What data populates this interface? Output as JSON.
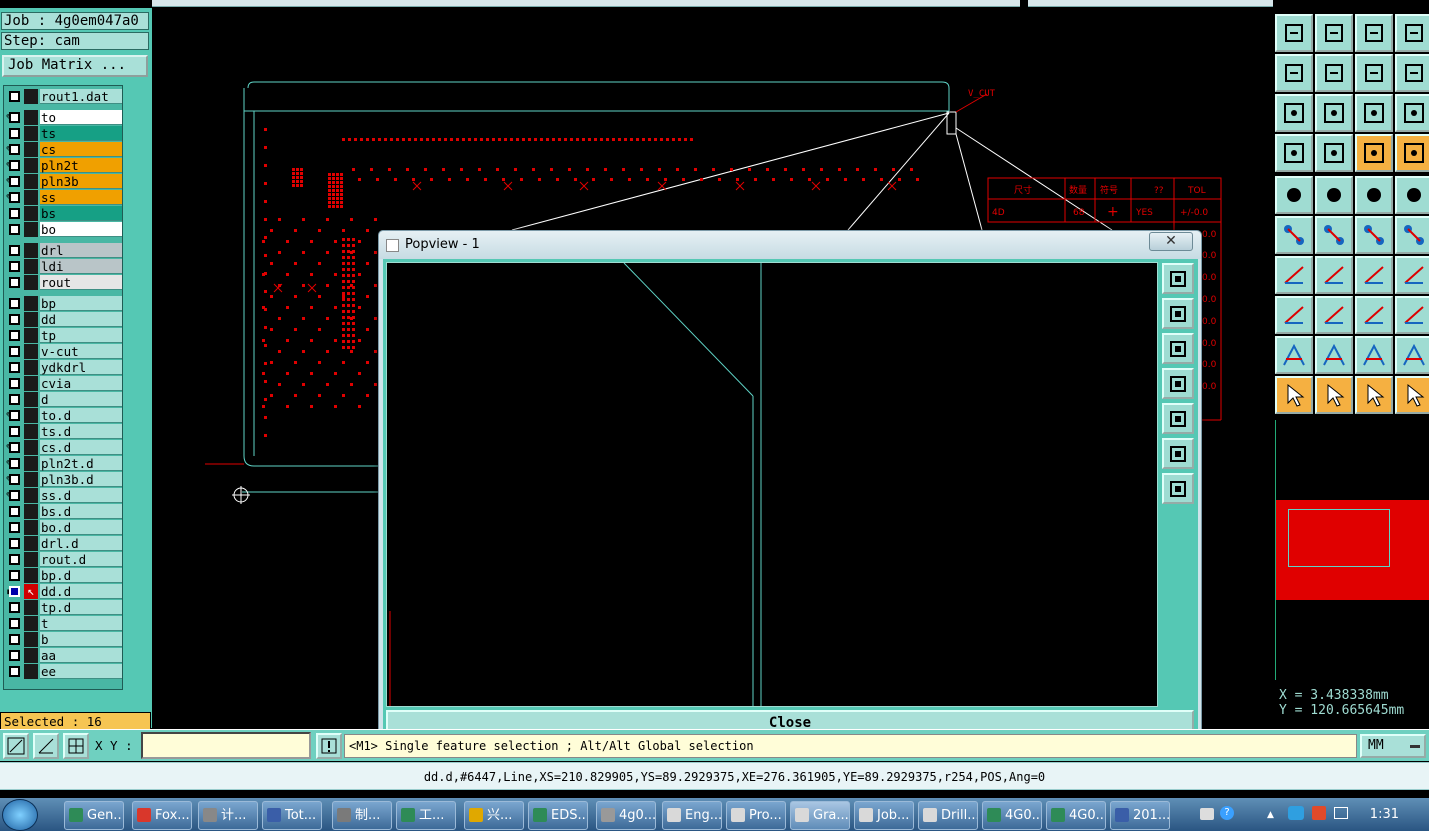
{
  "job": {
    "label": "Job : 4g0em047a0",
    "step": "Step: cam",
    "matrix_button": "Job Matrix ..."
  },
  "layers": [
    {
      "name": "rout1.dat",
      "color": "default",
      "icon": ""
    },
    {
      "name": "to",
      "color": "white",
      "icon": "hand-icon"
    },
    {
      "name": "ts",
      "color": "green",
      "icon": ""
    },
    {
      "name": "cs",
      "color": "orange",
      "icon": "hand-icon"
    },
    {
      "name": "pln2t",
      "color": "orange",
      "icon": "hand-icon"
    },
    {
      "name": "pln3b",
      "color": "orange",
      "icon": "hand-icon"
    },
    {
      "name": "ss",
      "color": "orange",
      "icon": "hand-icon"
    },
    {
      "name": "bs",
      "color": "green",
      "icon": ""
    },
    {
      "name": "bo",
      "color": "white",
      "icon": ""
    },
    {
      "name": "drl",
      "color": "gray",
      "icon": ""
    },
    {
      "name": "ldi",
      "color": "gray",
      "icon": ""
    },
    {
      "name": "rout",
      "color": "lgray",
      "icon": ""
    },
    {
      "name": "bp",
      "color": "default",
      "icon": ""
    },
    {
      "name": "dd",
      "color": "default",
      "icon": ""
    },
    {
      "name": "tp",
      "color": "default",
      "icon": ""
    },
    {
      "name": "v-cut",
      "color": "default",
      "icon": ""
    },
    {
      "name": "ydkdrl",
      "color": "default",
      "icon": ""
    },
    {
      "name": "cvia",
      "color": "default",
      "icon": ""
    },
    {
      "name": "d",
      "color": "default",
      "icon": ""
    },
    {
      "name": "to.d",
      "color": "default",
      "icon": "hand-icon"
    },
    {
      "name": "ts.d",
      "color": "default",
      "icon": ""
    },
    {
      "name": "cs.d",
      "color": "default",
      "icon": "hand-icon"
    },
    {
      "name": "pln2t.d",
      "color": "default",
      "icon": "hand-icon"
    },
    {
      "name": "pln3b.d",
      "color": "default",
      "icon": "hand-icon"
    },
    {
      "name": "ss.d",
      "color": "default",
      "icon": "hand-icon"
    },
    {
      "name": "bs.d",
      "color": "default",
      "icon": ""
    },
    {
      "name": "bo.d",
      "color": "default",
      "icon": ""
    },
    {
      "name": "drl.d",
      "color": "default",
      "icon": ""
    },
    {
      "name": "rout.d",
      "color": "default",
      "icon": ""
    },
    {
      "name": "bp.d",
      "color": "default",
      "icon": ""
    },
    {
      "name": "dd.d",
      "color": "default",
      "icon": "affected",
      "work": true
    },
    {
      "name": "tp.d",
      "color": "default",
      "icon": ""
    },
    {
      "name": "t",
      "color": "default",
      "icon": ""
    },
    {
      "name": "b",
      "color": "default",
      "icon": ""
    },
    {
      "name": "aa",
      "color": "default",
      "icon": ""
    },
    {
      "name": "ee",
      "color": "default",
      "icon": ""
    }
  ],
  "selected": "Selected : 16",
  "canvas": {
    "vcut_label": "V_CUT",
    "table_headers": [
      "尺寸",
      "数量",
      "符号",
      "??",
      "TOL"
    ],
    "table_row": [
      "4D",
      "68",
      "+",
      "YES",
      "+/-0.0"
    ],
    "table_tail": [
      "0.0",
      "0.0",
      "0.0",
      "0.0",
      "0.0",
      "0.0",
      "0.0",
      "0.0"
    ]
  },
  "popview": {
    "title": "Popview - 1",
    "close_x": "✕",
    "close_button": "Close"
  },
  "coords": {
    "x": "X = 3.438338mm",
    "y": "Y = 120.665645mm"
  },
  "cmd": {
    "xy_label": "X Y :",
    "xy_value": "",
    "message": "<M1>  Single feature selection ; Alt/Alt Global selection",
    "unit": "MM"
  },
  "info": "dd.d,#6447,Line,XS=210.829905,YS=89.2929375,XE=276.361905,YE=89.2929375,r254,POS,Ang=0",
  "taskbar": {
    "tasks": [
      "Gen...",
      "Fox...",
      "计...",
      "Tot...",
      "制...",
      "工...",
      "兴...",
      "EDS...",
      "4g0...",
      "Eng...",
      "Pro...",
      "Gra...",
      "Job...",
      "Drill...",
      "4G0...",
      "4G0...",
      "201..."
    ],
    "clock": "1:31"
  },
  "colors": {
    "panel": "#55c8b4",
    "accent_red": "#e00000",
    "cyan_line": "#5fd3c6",
    "orange": "#f0a000"
  }
}
